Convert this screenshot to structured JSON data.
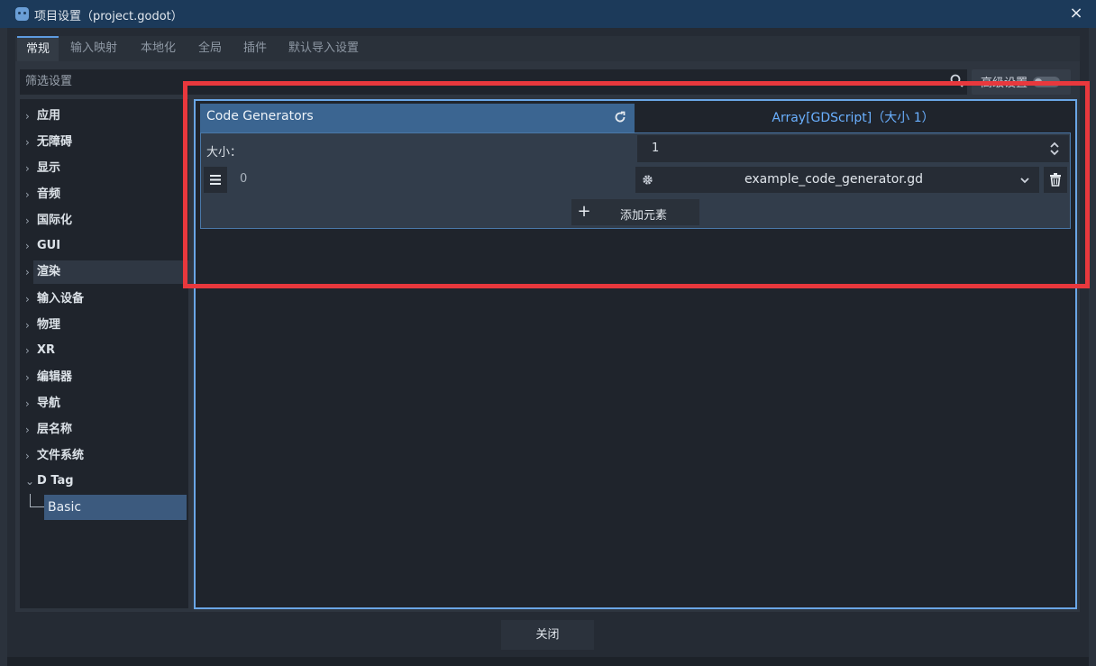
{
  "window": {
    "title": "项目设置（project.godot）",
    "close_symbol": "×"
  },
  "tabs": [
    {
      "label": "常规",
      "active": true
    },
    {
      "label": "输入映射"
    },
    {
      "label": "本地化"
    },
    {
      "label": "全局"
    },
    {
      "label": "插件"
    },
    {
      "label": "默认导入设置"
    }
  ],
  "filter": {
    "placeholder": "筛选设置",
    "advanced_label": "高级设置"
  },
  "sidebar": {
    "items": [
      {
        "label": "应用",
        "chevron": "›"
      },
      {
        "label": "无障碍",
        "chevron": "›"
      },
      {
        "label": "显示",
        "chevron": "›"
      },
      {
        "label": "音频",
        "chevron": "›"
      },
      {
        "label": "国际化",
        "chevron": "›"
      },
      {
        "label": "GUI",
        "chevron": "›"
      },
      {
        "label": "渲染",
        "chevron": "›"
      },
      {
        "label": "输入设备",
        "chevron": "›"
      },
      {
        "label": "物理",
        "chevron": "›"
      },
      {
        "label": "XR",
        "chevron": "›"
      },
      {
        "label": "编辑器",
        "chevron": "›"
      },
      {
        "label": "导航",
        "chevron": "›"
      },
      {
        "label": "层名称",
        "chevron": "›"
      },
      {
        "label": "文件系统",
        "chevron": "›"
      },
      {
        "label": "D Tag",
        "chevron": "⌄"
      }
    ],
    "selected_child": "Basic"
  },
  "inspector": {
    "property_name": "Code Generators",
    "property_type": "Array[GDScript]（大小 1）",
    "size_label": "大小：",
    "size_value": "1",
    "element_index": "0",
    "element_resource": "example_code_generator.gd",
    "add_element_label": "添加元素",
    "add_symbol": "+"
  },
  "footer": {
    "close_label": "关闭"
  },
  "colors": {
    "accent": "#6aa6e6",
    "highlight": "#e8383d",
    "type_link": "#6ab0ff"
  }
}
